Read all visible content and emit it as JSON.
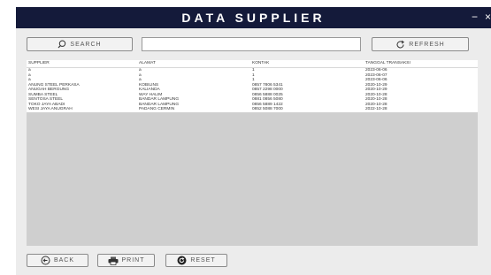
{
  "window": {
    "title": "DATA SUPPLIER",
    "minimize_label": "−",
    "close_label": "×"
  },
  "toolbar": {
    "search_label": "SEARCH",
    "search_value": "",
    "refresh_label": "REFRESH"
  },
  "table": {
    "columns": [
      "SUPPLIER",
      "ALAMAT",
      "KONTAK",
      "TANGGAL TRANSAKSI"
    ],
    "rows": [
      [
        "a",
        "a",
        "1",
        "2023-06-06"
      ],
      [
        "a",
        "a",
        "1",
        "2023-06-07"
      ],
      [
        "a",
        "a",
        "1",
        "2023-06-06"
      ],
      [
        "ANUNG STEEL PERKASA",
        "KOBILINS",
        "0857 7806 5341",
        "2020-10-29"
      ],
      [
        "ANUGAH BERGUNG",
        "KALIANDA",
        "0857 2298 0000",
        "2020-10-29"
      ],
      [
        "SUMBA STEEL",
        "WAY HALIM",
        "0856 5888 0025",
        "2020-10-28"
      ],
      [
        "SENTOSA STEEL",
        "BANDAR LAMPUNG",
        "0881 0856 5080",
        "2020-10-28"
      ],
      [
        "TOKO JAYA ABADI",
        "BANDAR LAMPUNG",
        "0856 5889 1422",
        "2020-10-28"
      ],
      [
        "WESI JAYA ANUGRAH",
        "PADANG CERMIN",
        "0852 5088 7000",
        "2022-10-28"
      ]
    ]
  },
  "footer": {
    "back_label": "BACK",
    "print_label": "PRINT",
    "reset_label": "RESET"
  }
}
